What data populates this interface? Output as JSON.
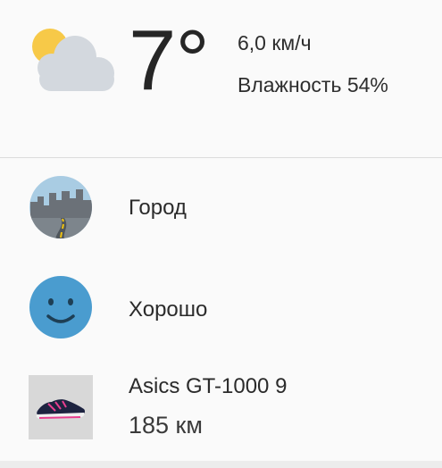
{
  "weather": {
    "icon": "partly-cloudy-icon",
    "temperature": "7°",
    "wind": "6,0 км/ч",
    "humidity": "Влажность 54%"
  },
  "environment": {
    "icon": "city-road-icon",
    "label": "Город"
  },
  "feeling": {
    "icon": "smiley-face-icon",
    "label": "Хорошо"
  },
  "shoe": {
    "icon": "running-shoe-icon",
    "name": "Asics GT-1000 9",
    "distance": "185 км"
  },
  "colors": {
    "sun": "#f7c948",
    "cloud": "#d3d8de",
    "smiley": "#4a9ccf",
    "city_sky": "#a9cce3",
    "road_line": "#f2c40f"
  }
}
